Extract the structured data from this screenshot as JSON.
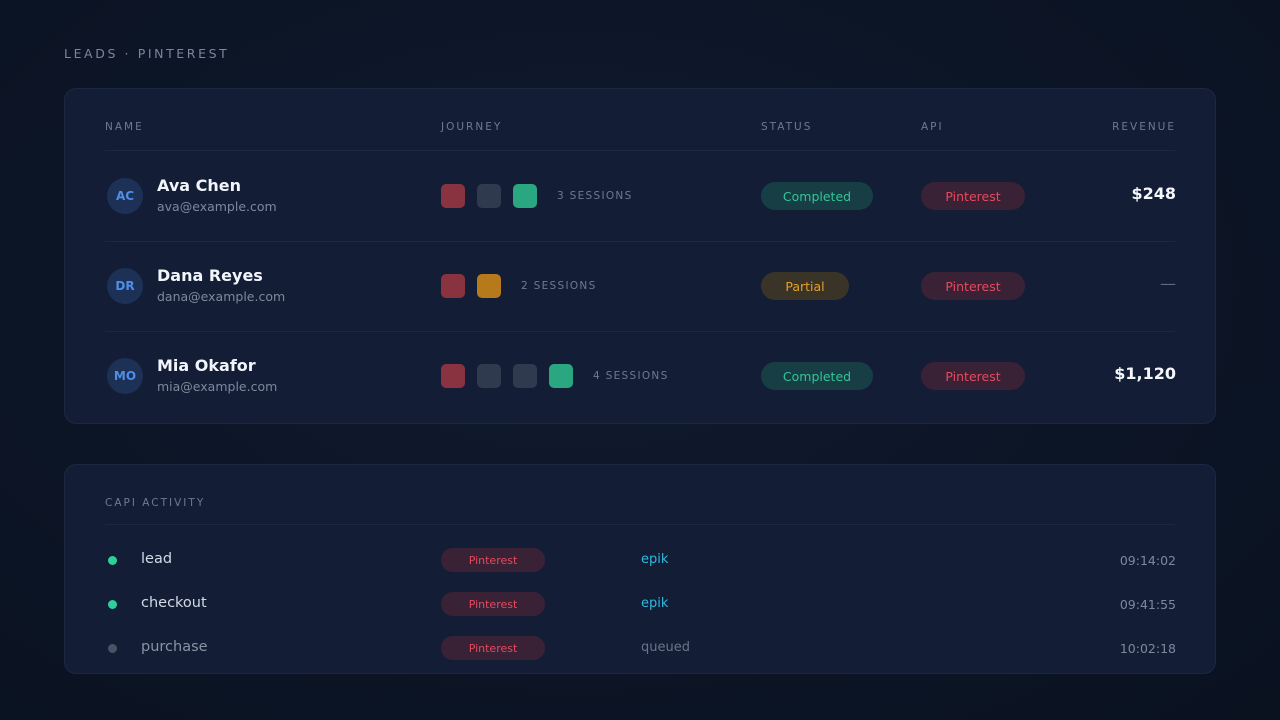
{
  "page": {
    "title": "LEADS · PINTEREST"
  },
  "leads": {
    "columns": {
      "name": "NAME",
      "journey": "JOURNEY",
      "status": "STATUS",
      "api": "API",
      "revenue": "REVENUE"
    },
    "rows": [
      {
        "initials": "AC",
        "name": "Ava Chen",
        "email": "ava@example.com",
        "journey_steps": [
          "red",
          "gray",
          "green"
        ],
        "sessions": "3 SESSIONS",
        "status": "Completed",
        "api": "Pinterest",
        "revenue": "$248"
      },
      {
        "initials": "DR",
        "name": "Dana Reyes",
        "email": "dana@example.com",
        "journey_steps": [
          "red",
          "amber"
        ],
        "sessions": "2 SESSIONS",
        "status": "Partial",
        "api": "Pinterest",
        "revenue": "—"
      },
      {
        "initials": "MO",
        "name": "Mia Okafor",
        "email": "mia@example.com",
        "journey_steps": [
          "red",
          "gray",
          "gray",
          "green"
        ],
        "sessions": "4 SESSIONS",
        "status": "Completed",
        "api": "Pinterest",
        "revenue": "$1,120"
      }
    ]
  },
  "activity": {
    "title": "CAPI ACTIVITY",
    "rows": [
      {
        "event": "lead",
        "state": "sent",
        "platform": "Pinterest",
        "via": "epik",
        "time": "09:14:02"
      },
      {
        "event": "checkout",
        "state": "sent",
        "platform": "Pinterest",
        "via": "epik",
        "time": "09:41:55"
      },
      {
        "event": "purchase",
        "state": "queued",
        "platform": "Pinterest",
        "via": "queued",
        "time": "10:02:18"
      }
    ]
  },
  "colors": {
    "background": "#0c1526",
    "card": "#131e36",
    "completed": "#35c497",
    "partial": "#e4a024",
    "pinterest": "#e5495d",
    "avatar": "#4f8fe8",
    "link": "#2fb9df"
  }
}
